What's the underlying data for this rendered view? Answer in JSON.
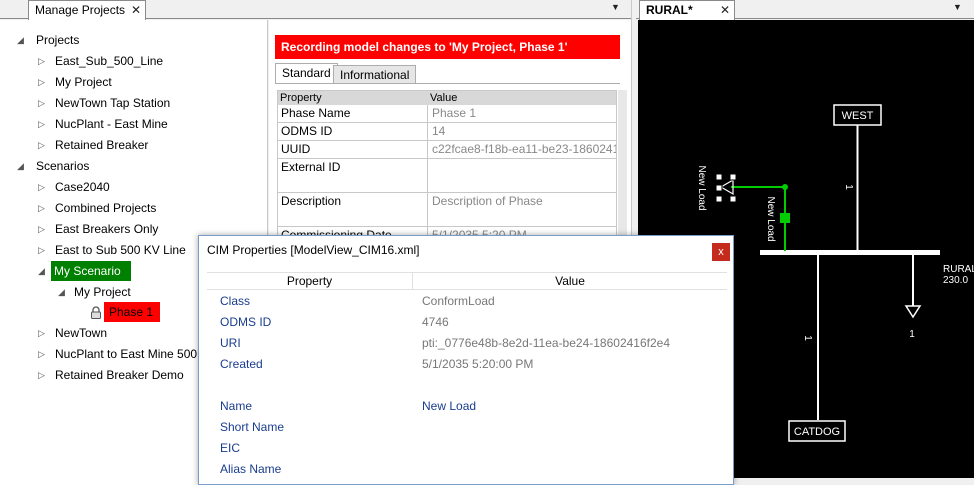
{
  "left_pane": {
    "tab_title": "Manage Projects",
    "tab_close": "✕",
    "menu_glyph": "▼"
  },
  "tree": {
    "projects_header": "Projects",
    "projects": [
      "East_Sub_500_Line",
      "My Project",
      "NewTown Tap Station",
      "NucPlant - East Mine",
      "Retained Breaker"
    ],
    "scenarios_header": "Scenarios",
    "scenarios_before": [
      "Case2040",
      "Combined Projects",
      "East Breakers Only",
      "East to Sub 500 KV Line"
    ],
    "selected_scenario": "My Scenario",
    "selected_project": "My Project",
    "selected_phase": "Phase 1",
    "scenarios_after": [
      "NewTown",
      "NucPlant to East Mine 500",
      "Retained Breaker Demo"
    ],
    "colors": {
      "scenario_highlight": "#008000",
      "phase_highlight": "#ff0000"
    }
  },
  "phase_panel": {
    "banner": "Recording model changes to 'My Project, Phase 1'",
    "tabs": [
      "Standard",
      "Informational"
    ],
    "grid_headers": [
      "Property",
      "Value"
    ],
    "rows": [
      {
        "key": "Phase Name",
        "value": "Phase 1"
      },
      {
        "key": "ODMS ID",
        "value": "14"
      },
      {
        "key": "UUID",
        "value": "c22fcae8-f18b-ea11-be23-1860241"
      },
      {
        "key": "External ID",
        "value": ""
      },
      {
        "key": "Description",
        "value": "Description of Phase"
      },
      {
        "key": "Commissioning Date",
        "value": "5/1/2035 5:20 PM"
      }
    ]
  },
  "right_pane": {
    "tab_title": "RURAL*",
    "tab_close": "✕",
    "menu_glyph": "▼"
  },
  "diagram": {
    "bus_west_label": "WEST",
    "bus_catdog_label": "CATDOG",
    "bus_rural_label": "RURAL",
    "bus_rural_kv": "230.0",
    "load_label_left": "New Load",
    "load_label_right": "New Load",
    "branch_label_upper": "1",
    "branch_label_lower": "1",
    "load_number": "1",
    "colors": {
      "background": "#000000",
      "line": "#ffffff",
      "new_element": "#00cc00"
    }
  },
  "cim_dialog": {
    "title": "CIM Properties [ModelView_CIM16.xml]",
    "close_glyph": "x",
    "headers": [
      "Property",
      "Value"
    ],
    "rows": [
      {
        "key": "Class",
        "value": "ConformLoad"
      },
      {
        "key": "ODMS ID",
        "value": "4746"
      },
      {
        "key": "URI",
        "value": "pti:_0776e48b-8e2d-11ea-be24-18602416f2e4"
      },
      {
        "key": "Created",
        "value": "5/1/2035 5:20:00 PM"
      },
      {
        "key": "Name",
        "value": "New Load"
      },
      {
        "key": "Short Name",
        "value": ""
      },
      {
        "key": "EIC",
        "value": ""
      },
      {
        "key": "Alias Name",
        "value": ""
      }
    ]
  }
}
